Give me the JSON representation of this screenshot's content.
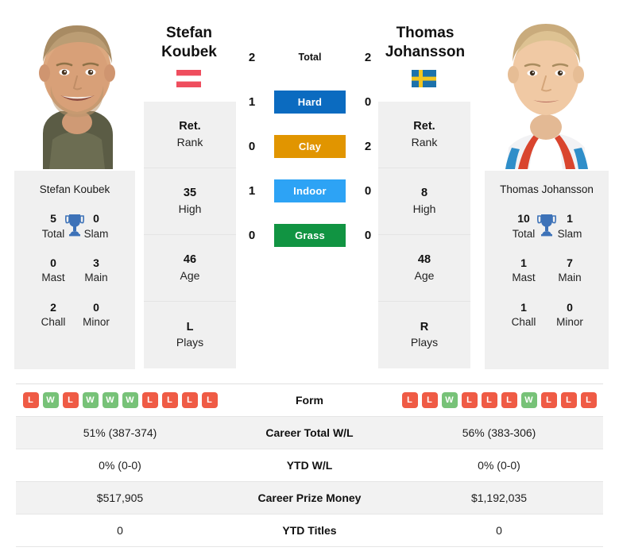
{
  "players": {
    "left": {
      "name_line1": "Stefan",
      "name_line2": "Koubek",
      "full_name": "Stefan Koubek",
      "flag": "austria-flag-icon",
      "rank": "Ret.",
      "rank_label": "Rank",
      "high": "35",
      "high_label": "High",
      "age": "46",
      "age_label": "Age",
      "plays": "L",
      "plays_label": "Plays",
      "titles": {
        "total": "5",
        "total_label": "Total",
        "slam": "0",
        "slam_label": "Slam",
        "mast": "0",
        "mast_label": "Mast",
        "main": "3",
        "main_label": "Main",
        "chall": "2",
        "chall_label": "Chall",
        "minor": "0",
        "minor_label": "Minor"
      }
    },
    "right": {
      "name_line1": "Thomas",
      "name_line2": "Johansson",
      "full_name": "Thomas Johansson",
      "flag": "sweden-flag-icon",
      "rank": "Ret.",
      "rank_label": "Rank",
      "high": "8",
      "high_label": "High",
      "age": "48",
      "age_label": "Age",
      "plays": "R",
      "plays_label": "Plays",
      "titles": {
        "total": "10",
        "total_label": "Total",
        "slam": "1",
        "slam_label": "Slam",
        "mast": "1",
        "mast_label": "Mast",
        "main": "7",
        "main_label": "Main",
        "chall": "1",
        "chall_label": "Chall",
        "minor": "0",
        "minor_label": "Minor"
      }
    }
  },
  "head_to_head": [
    {
      "label": "Total",
      "left": "2",
      "right": "2",
      "style": "plain",
      "color": ""
    },
    {
      "label": "Hard",
      "left": "1",
      "right": "0",
      "style": "badge",
      "color": "#0b6bc0"
    },
    {
      "label": "Clay",
      "left": "0",
      "right": "2",
      "style": "badge",
      "color": "#e19500"
    },
    {
      "label": "Indoor",
      "left": "1",
      "right": "0",
      "style": "badge",
      "color": "#2da3f5"
    },
    {
      "label": "Grass",
      "left": "0",
      "right": "0",
      "style": "badge",
      "color": "#119442"
    }
  ],
  "form": {
    "label": "Form",
    "left": [
      "L",
      "W",
      "L",
      "W",
      "W",
      "W",
      "L",
      "L",
      "L",
      "L"
    ],
    "right": [
      "L",
      "L",
      "W",
      "L",
      "L",
      "L",
      "W",
      "L",
      "L",
      "L"
    ],
    "win_color": "#77c278",
    "loss_color": "#ef5b45"
  },
  "stats_rows": [
    {
      "label": "Career Total W/L",
      "left": "51% (387-374)",
      "right": "56% (383-306)"
    },
    {
      "label": "YTD W/L",
      "left": "0% (0-0)",
      "right": "0% (0-0)"
    },
    {
      "label": "Career Prize Money",
      "left": "$517,905",
      "right": "$1,192,035"
    },
    {
      "label": "YTD Titles",
      "left": "0",
      "right": "0"
    }
  ],
  "icons": {
    "trophy": "trophy-icon"
  }
}
